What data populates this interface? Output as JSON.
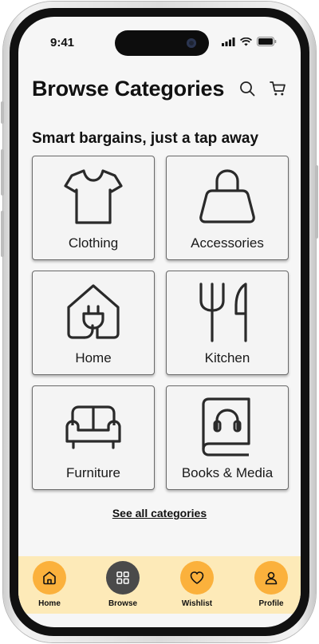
{
  "status_bar": {
    "time": "9:41"
  },
  "header": {
    "title": "Browse Categories",
    "search_icon": "search-icon",
    "cart_icon": "cart-icon"
  },
  "subtitle": "Smart bargains, just a tap away",
  "categories": [
    {
      "label": "Clothing",
      "icon": "tshirt-icon"
    },
    {
      "label": "Accessories",
      "icon": "handbag-icon"
    },
    {
      "label": "Home",
      "icon": "house-plug-icon"
    },
    {
      "label": "Kitchen",
      "icon": "fork-knife-icon"
    },
    {
      "label": "Furniture",
      "icon": "sofa-icon"
    },
    {
      "label": "Books & Media",
      "icon": "book-headphones-icon"
    }
  ],
  "see_all_label": "See all categories",
  "tabbar": {
    "tabs": [
      {
        "label": "Home",
        "icon": "home-icon",
        "active": false
      },
      {
        "label": "Browse",
        "icon": "grid-icon",
        "active": true
      },
      {
        "label": "Wishlist",
        "icon": "heart-icon",
        "active": false
      },
      {
        "label": "Profile",
        "icon": "user-icon",
        "active": false
      }
    ]
  },
  "colors": {
    "accent": "#fbb13c",
    "active_tab": "#4a4a4a",
    "tabbar_bg": "#fdeab8",
    "screen_bg": "#f6f6f6"
  }
}
